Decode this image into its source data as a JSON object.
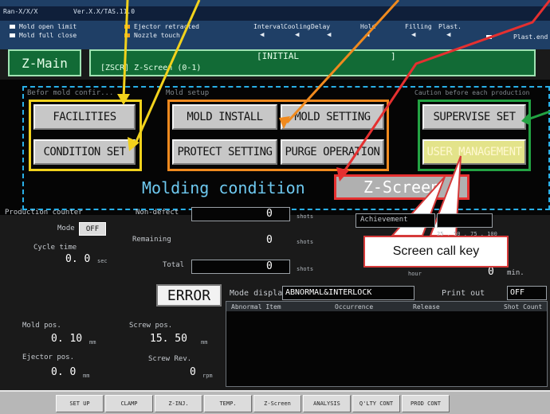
{
  "header": {
    "sys_left": "Ran-X/X/X",
    "sys_right": "Ver.X.X/TAS.11.0",
    "status": [
      "Mold open limit",
      "Mold full close",
      "Ejector retracted",
      "Nozzle touch"
    ],
    "status_colors": [
      "#ffffff",
      "#ffffff",
      "#f0a020",
      "#f0a020"
    ],
    "cycle_labels": [
      "Interval",
      "Cooling",
      "Delay",
      "Hold",
      "Filling",
      "Plast.",
      "Plast.end"
    ],
    "screen_title": "Z-Main",
    "screen_mode": "[INITIAL",
    "screen_mode_close": "]",
    "screen_path": "[ZSCR] Z-Screen (0-1)"
  },
  "groups": {
    "before_mold": "Befor mold confir...",
    "mold_setup": "Mold setup",
    "caution": "Caution before each production"
  },
  "buttons": {
    "facilities": "FACILITIES",
    "condition_set": "CONDITION SET",
    "mold_install": "MOLD INSTALL",
    "mold_setting": "MOLD SETTING",
    "protect_setting": "PROTECT SETTING",
    "purge_operation": "PURGE OPERATION",
    "supervise_set": "SUPERVISE SET",
    "user_management": "USER MANAGEMENT"
  },
  "molding": {
    "label": "Molding condition",
    "zscreen": "Z-Screen"
  },
  "callout": "Screen call key",
  "production": {
    "title": "Production counter",
    "mode_label": "Mode",
    "mode_value": "OFF",
    "cycle_label": "Cycle time",
    "cycle_value": "0. 0",
    "cycle_unit": "sec",
    "nondefect_label": "Non-defect",
    "nondefect_value": "0",
    "remaining_label": "Remaining",
    "remaining_value": "0",
    "total_label": "Total",
    "total_value": "0",
    "shots_unit": "shots",
    "achievement_label": "Achievement",
    "ach_ticks": "25 . 50 . 75 . 100",
    "hour_label": "hour",
    "min_value": "0",
    "min_label": "min."
  },
  "error": {
    "label": "ERROR",
    "mode_display_label": "Mode display",
    "mode_display_value": "ABNORMAL&INTERLOCK",
    "print_out_label": "Print out",
    "print_out_value": "OFF",
    "columns": [
      "Abnormal Item",
      "Occurrence",
      "Release",
      "Shot Count"
    ]
  },
  "positions": {
    "mold_label": "Mold pos.",
    "mold_value": "0. 10",
    "mold_unit": "mm",
    "screw_label": "Screw pos.",
    "screw_value": "15. 50",
    "screw_unit": "mm",
    "ejector_label": "Ejector pos.",
    "ejector_value": "0. 0",
    "ejector_unit": "mm",
    "rev_label": "Screw Rev.",
    "rev_value": "0",
    "rev_unit": "rpm"
  },
  "nav": [
    "SET UP",
    "CLAMP",
    "Z-INJ.",
    "TEMP.",
    "Z-Screen",
    "ANALYSIS",
    "Q'LTY CONT",
    "PROD CONT"
  ],
  "colors": {
    "group_yellow": "#f2d21c",
    "group_orange": "#f08a1e",
    "group_green": "#23a343",
    "dashed_blue": "#29b0e8",
    "callout_red": "#e53030"
  }
}
